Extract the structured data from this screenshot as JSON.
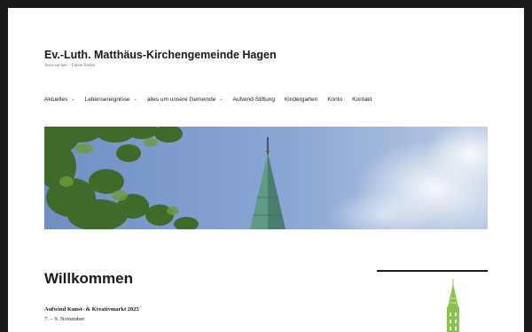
{
  "site": {
    "title": "Ev.-Luth. Matthäus-Kirchengemeinde Hagen",
    "tagline": "Jesus suchen – Leben finden"
  },
  "nav": {
    "items": [
      {
        "label": "Aktuelles",
        "has_submenu": true
      },
      {
        "label": "Lebensereignisse",
        "has_submenu": true
      },
      {
        "label": "alles um unsere Gemeinde",
        "has_submenu": true
      },
      {
        "label": "Aufwind-Stiftung",
        "has_submenu": false
      },
      {
        "label": "Kindergarten",
        "has_submenu": false
      },
      {
        "label": "Konto",
        "has_submenu": false
      },
      {
        "label": "Kontakt",
        "has_submenu": false
      }
    ],
    "chevron_icon": "chevron-down-icon"
  },
  "hero": {
    "image": "church-spire-against-blue-sky",
    "colors": {
      "sky": "#7f9fd0",
      "spire": "#5f9a86",
      "leaves": "#3f6a2a"
    }
  },
  "main": {
    "heading": "Willkommen",
    "post": {
      "title": "Aufwind Kunst- & Kreativmarkt 2025",
      "date": "7. – 9. November"
    }
  },
  "sidebar": {
    "image": "green-church-tower-logo",
    "accent": "#8bc34a"
  }
}
